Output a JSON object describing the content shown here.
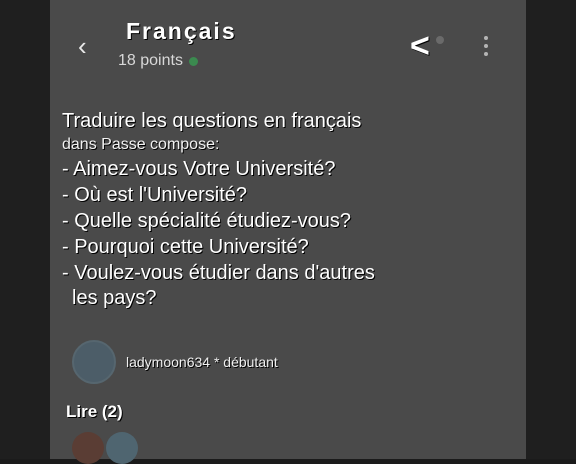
{
  "header": {
    "title": "Français",
    "points": "18 points"
  },
  "question": {
    "line1": "Traduire les questions en français",
    "line2": "dans Passe compose:",
    "items": [
      "- Aimez-vous Votre Université?",
      "- Où est l'Université?",
      "- Quelle spécialité étudiez-vous?",
      "- Pourquoi cette Université?",
      "- Voulez-vous étudier dans d'autres"
    ],
    "last_continuation": "les pays?"
  },
  "author": {
    "name_rank": "ladymoon634 * débutant"
  },
  "reads": {
    "label": "Lire (2)"
  },
  "icons": {
    "back": "chevron-left-icon",
    "share": "share-icon",
    "more": "more-vertical-icon"
  },
  "colors": {
    "screen_bg": "#4a4a4a",
    "points_dot": "#3b8a4f"
  }
}
